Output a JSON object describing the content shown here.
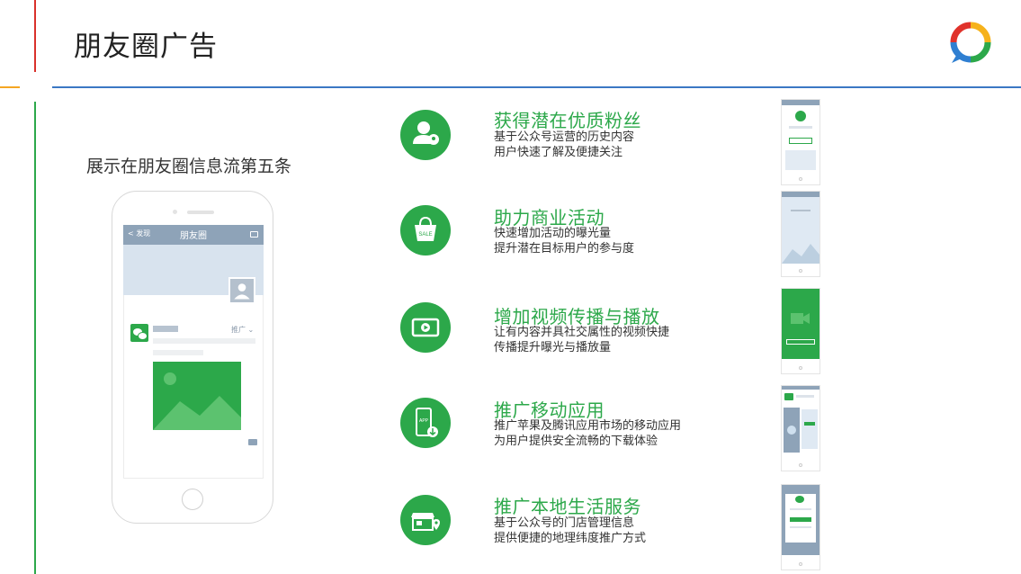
{
  "header": {
    "title": "朋友圈广告",
    "logo_icon": "speech-ring-logo-icon"
  },
  "subtitle": "展示在朋友圈信息流第五条",
  "phone": {
    "nav_back": "< 发现",
    "nav_title": "朋友圈",
    "post_tag": "推广 ⌄"
  },
  "features": [
    {
      "icon": "user-location-icon",
      "title": "获得潜在优质粉丝",
      "lines": [
        "基于公众号运营的历史内容",
        "用户快速了解及便捷关注"
      ]
    },
    {
      "icon": "sale-bag-icon",
      "title": "助力商业活动",
      "lines": [
        "快速增加活动的曝光量",
        "提升潜在目标用户的参与度"
      ]
    },
    {
      "icon": "video-play-icon",
      "title": "增加视频传播与播放",
      "lines": [
        "让有内容并具社交属性的视频快捷",
        "传播提升曝光与播放量"
      ]
    },
    {
      "icon": "app-download-icon",
      "title": "推广移动应用",
      "lines": [
        "推广苹果及腾讯应用市场的移动应用",
        "为用户提供安全流畅的下载体验"
      ]
    },
    {
      "icon": "store-location-icon",
      "title": "推广本地生活服务",
      "lines": [
        "基于公众号的门店管理信息",
        "提供便捷的地理纬度推广方式"
      ]
    }
  ],
  "colors": {
    "accent_green": "#2ca84a",
    "header_blue": "#3b78c4",
    "header_red": "#d9312b",
    "header_orange": "#f5a623"
  }
}
